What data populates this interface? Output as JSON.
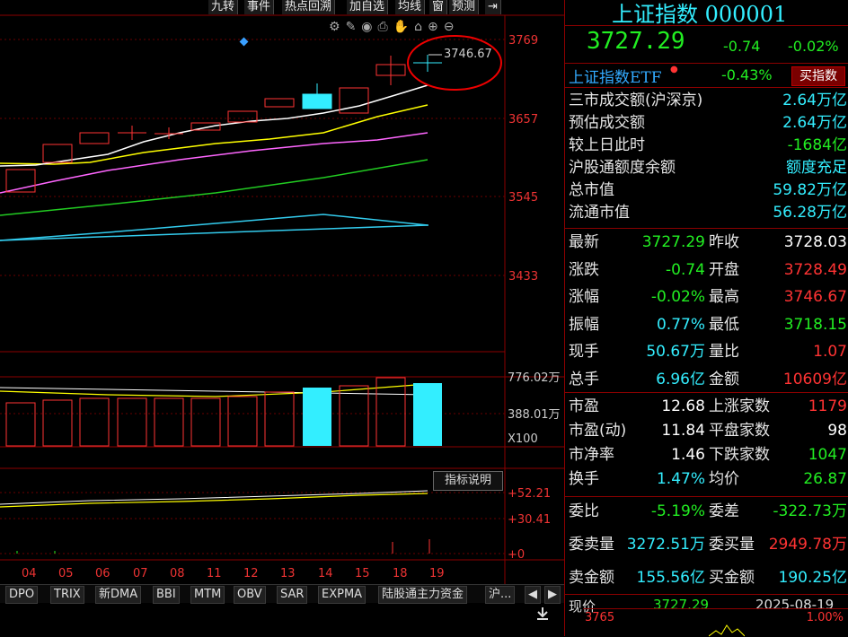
{
  "toolbar": {
    "buttons": [
      "九转",
      "事件",
      "热点回溯",
      "加自选",
      "均线",
      "窗",
      "预测"
    ]
  },
  "chart_data": {
    "type": "candlestick",
    "price_axis": [
      "3769",
      "3657",
      "3545",
      "3433"
    ],
    "volume_axis": [
      "776.02万",
      "388.01万",
      "X100"
    ],
    "indicator_axis": [
      "+52.21",
      "+30.41",
      "+0"
    ],
    "dates": [
      "04",
      "05",
      "06",
      "07",
      "08",
      "11",
      "12",
      "13",
      "14",
      "15",
      "18",
      "19"
    ],
    "high_annotation": "3746.67",
    "explain_button": "指标说明"
  },
  "indicator_tabs": [
    "DPO",
    "TRIX",
    "新DMA",
    "BBI",
    "MTM",
    "OBV",
    "SAR",
    "EXPMA",
    "陆股通主力资金",
    "沪..."
  ],
  "panel": {
    "title": "上证指数 000001",
    "price": "3727.29",
    "change": "-0.74",
    "change_pct": "-0.02%",
    "etf_label": "上证指数ETF",
    "etf_pct": "-0.43%",
    "etf_button": "买指数",
    "stats": [
      {
        "label": "三市成交额(沪深京)",
        "value": "2.64万亿"
      },
      {
        "label": "预估成交额",
        "value": "2.64万亿"
      },
      {
        "label": "较上日此时",
        "value": "-1684亿"
      },
      {
        "label": "沪股通额度余额",
        "value": "额度充足"
      },
      {
        "label": "总市值",
        "value": "59.82万亿"
      },
      {
        "label": "流通市值",
        "value": "56.28万亿"
      }
    ],
    "quote": [
      {
        "l1": "最新",
        "v1": "3727.29",
        "l2": "昨收",
        "v2": "3728.03"
      },
      {
        "l1": "涨跌",
        "v1": "-0.74",
        "l2": "开盘",
        "v2": "3728.49"
      },
      {
        "l1": "涨幅",
        "v1": "-0.02%",
        "l2": "最高",
        "v2": "3746.67"
      },
      {
        "l1": "振幅",
        "v1": "0.77%",
        "l2": "最低",
        "v2": "3718.15"
      },
      {
        "l1": "现手",
        "v1": "50.67万",
        "l2": "量比",
        "v2": "1.07"
      },
      {
        "l1": "总手",
        "v1": "6.96亿",
        "l2": "金额",
        "v2": "10609亿"
      }
    ],
    "valuation": [
      {
        "l1": "市盈",
        "v1": "12.68",
        "l2": "上涨家数",
        "v2": "1179"
      },
      {
        "l1": "市盈(动)",
        "v1": "11.84",
        "l2": "平盘家数",
        "v2": "98"
      },
      {
        "l1": "市净率",
        "v1": "1.46",
        "l2": "下跌家数",
        "v2": "1047"
      },
      {
        "l1": "换手",
        "v1": "1.47%",
        "l2": "均价",
        "v2": "26.87"
      }
    ],
    "order": [
      {
        "l1": "委比",
        "v1": "-5.19%",
        "l2": "委差",
        "v2": "-322.73万"
      },
      {
        "l1": "委卖量",
        "v1": "3272.51万",
        "l2": "委买量",
        "v2": "2949.78万"
      },
      {
        "l1": "卖金额",
        "v1": "155.56亿",
        "l2": "买金额",
        "v2": "190.25亿"
      }
    ],
    "bottom": {
      "label": "现价",
      "value": "3727.29",
      "date": "2025-08-19",
      "axis_left": "3765",
      "axis_right": "1.00%"
    }
  },
  "colors": {
    "up": "#ff3333",
    "down": "#33eeff",
    "ma5": "#ffffff",
    "ma10": "#ffff00",
    "ma20": "#ff66ff",
    "ma30": "#22cc22",
    "ma60": "#33ccee"
  }
}
